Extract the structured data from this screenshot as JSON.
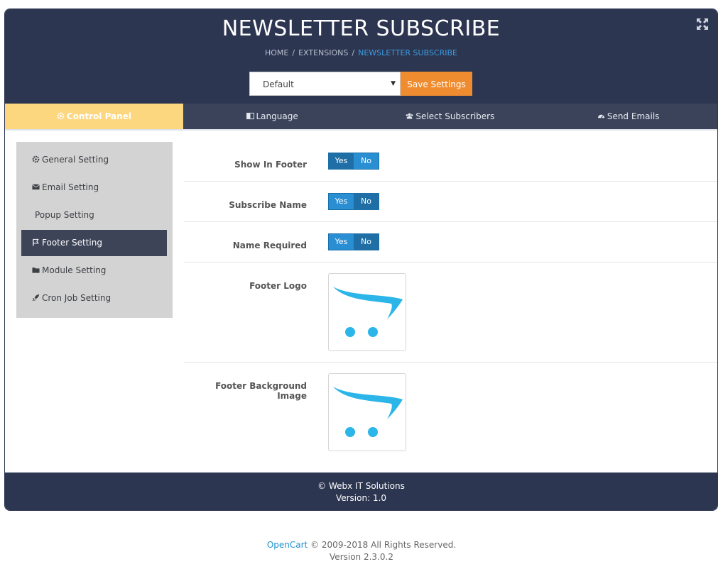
{
  "header": {
    "title": "NEWSLETTER SUBSCRIBE",
    "breadcrumb": [
      "HOME",
      "EXTENSIONS",
      "NEWSLETTER SUBSCRIBE"
    ]
  },
  "store_select": {
    "value": "Default"
  },
  "save_button": {
    "label": "Save Settings"
  },
  "tabs": [
    {
      "label": "Control Panel",
      "icon": "gear-icon",
      "active": true
    },
    {
      "label": "Language",
      "icon": "language-icon",
      "active": false
    },
    {
      "label": "Select Subscribers",
      "icon": "users-icon",
      "active": false
    },
    {
      "label": "Send Emails",
      "icon": "dashboard-icon",
      "active": false
    }
  ],
  "sidebar": {
    "items": [
      {
        "label": "General Setting",
        "icon": "gear-icon"
      },
      {
        "label": "Email Setting",
        "icon": "envelope-icon"
      },
      {
        "label": "Popup Setting",
        "icon": ""
      },
      {
        "label": "Footer Setting",
        "icon": "flag-icon",
        "active": true
      },
      {
        "label": "Module Setting",
        "icon": "folder-icon"
      },
      {
        "label": "Cron Job Setting",
        "icon": "rocket-icon"
      }
    ]
  },
  "form": {
    "show_in_footer": {
      "label": "Show In Footer",
      "yes": "Yes",
      "no": "No",
      "value": "Yes"
    },
    "subscribe_name": {
      "label": "Subscribe Name",
      "yes": "Yes",
      "no": "No",
      "value": "No"
    },
    "name_required": {
      "label": "Name Required",
      "yes": "Yes",
      "no": "No",
      "value": "No"
    },
    "footer_logo": {
      "label": "Footer Logo",
      "image": "opencart-cart-logo"
    },
    "footer_bg": {
      "label": "Footer Background Image",
      "image": "opencart-cart-logo"
    }
  },
  "footer": {
    "line1": "© Webx IT Solutions",
    "line2": "Version: 1.0"
  },
  "page_footer": {
    "link": "OpenCart",
    "copyright": "© 2009-2018 All Rights Reserved.",
    "version": "Version 2.3.0.2"
  },
  "colors": {
    "header_bg": "#2d3651",
    "tab_active": "#fdd780",
    "accent_orange": "#f08c30",
    "toggle_blue": "#2a8ed3",
    "toggle_selected": "#1f6ea6"
  }
}
